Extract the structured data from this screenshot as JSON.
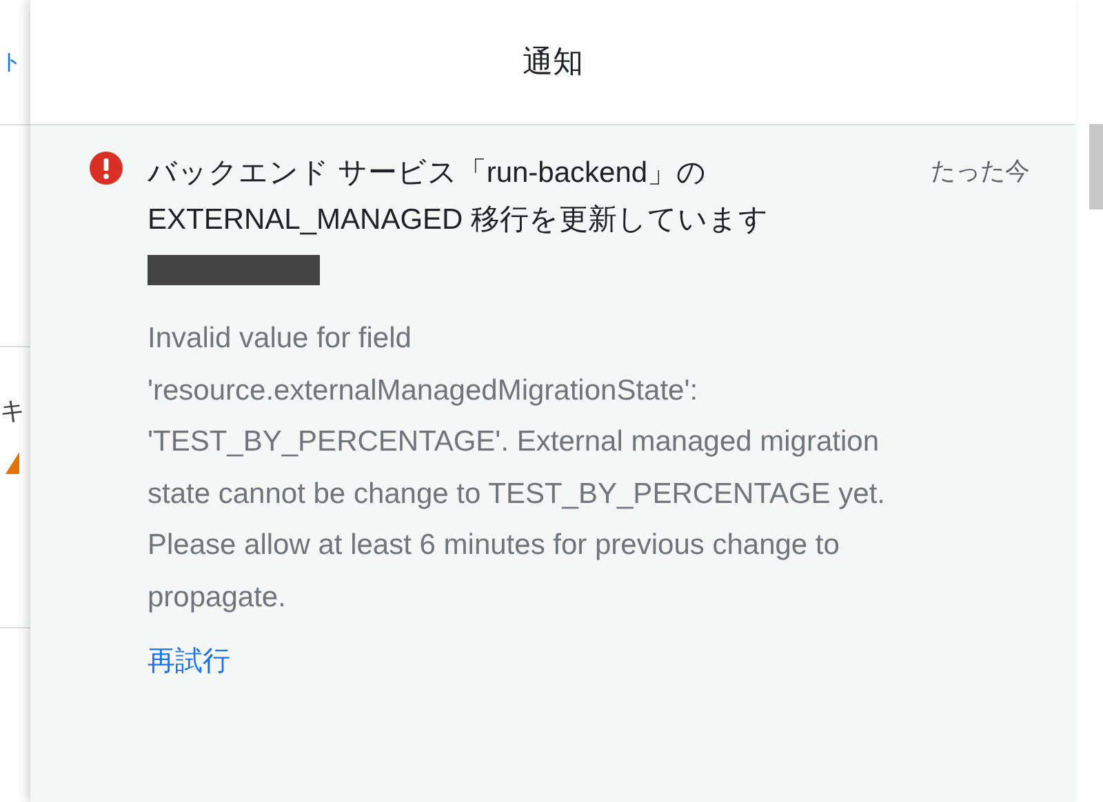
{
  "background": {
    "link_fragment": "ト",
    "text_fragment": "キ"
  },
  "panel": {
    "title": "通知"
  },
  "notifications": [
    {
      "kind": "error",
      "title": "バックエンド サービス「run-backend」の EXTERNAL_MANAGED 移行を更新しています",
      "time": "たった今",
      "message": "Invalid value for field 'resource.externalManagedMigrationState': 'TEST_BY_PERCENTAGE'. External managed migration state cannot be change to TEST_BY_PERCENTAGE yet. Please allow at least 6 minutes for previous change to propagate.",
      "action": "再試行"
    }
  ]
}
